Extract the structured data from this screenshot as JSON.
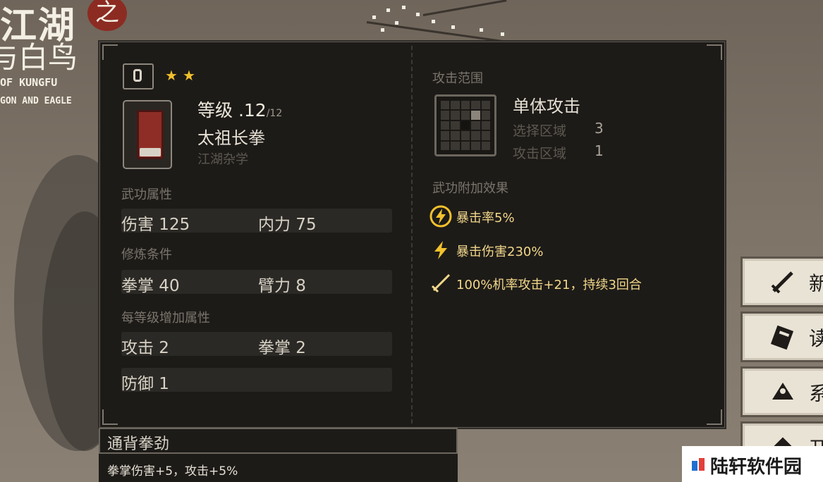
{
  "logo": {
    "line1": "江湖",
    "seal": "之",
    "line2": "神雕侠侣与白鸟",
    "en1": "OF KUNGFU",
    "en2": "GON AND EAGLE"
  },
  "skill": {
    "level_label": "等级 .12",
    "level_max": "/12",
    "stars": 2,
    "name": "太祖长拳",
    "type": "江湖杂学"
  },
  "attributes": {
    "title": "武功属性",
    "damage_label": "伤害 125",
    "internal_label": "内力 75"
  },
  "requirements": {
    "title": "修炼条件",
    "fist_label": "拳掌 40",
    "arm_label": "臂力 8"
  },
  "per_level": {
    "title": "每等级增加属性",
    "attack_label": "攻击 2",
    "fist_label": "拳掌 2",
    "defense_label": "防御 1"
  },
  "range": {
    "title": "攻击范围",
    "type": "单体攻击",
    "select_label": "选择区域",
    "select_value": "3",
    "attack_label": "攻击区域",
    "attack_value": "1"
  },
  "effects": {
    "title": "武功附加效果",
    "items": [
      {
        "icon": "lightning-circle-icon",
        "text": "暴击率5%"
      },
      {
        "icon": "lightning-icon",
        "text": "暴击伤害230%"
      },
      {
        "icon": "sword-icon",
        "text": "100%机率攻击+21，持续3回合"
      }
    ]
  },
  "bonus": {
    "title": "通背拳劲",
    "text": "拳掌伤害+5，攻击+5%"
  },
  "side_menu": [
    {
      "icon": "sword-icon",
      "label": "新"
    },
    {
      "icon": "book-icon",
      "label": "读"
    },
    {
      "icon": "rice-ball-icon",
      "label": "系"
    },
    {
      "icon": "scroll-icon",
      "label": "开"
    }
  ],
  "watermark": "陆轩软件园",
  "colors": {
    "star": "#f2c12c",
    "effect_text": "#f2d78a",
    "panel_bg": "#1d1b18"
  }
}
